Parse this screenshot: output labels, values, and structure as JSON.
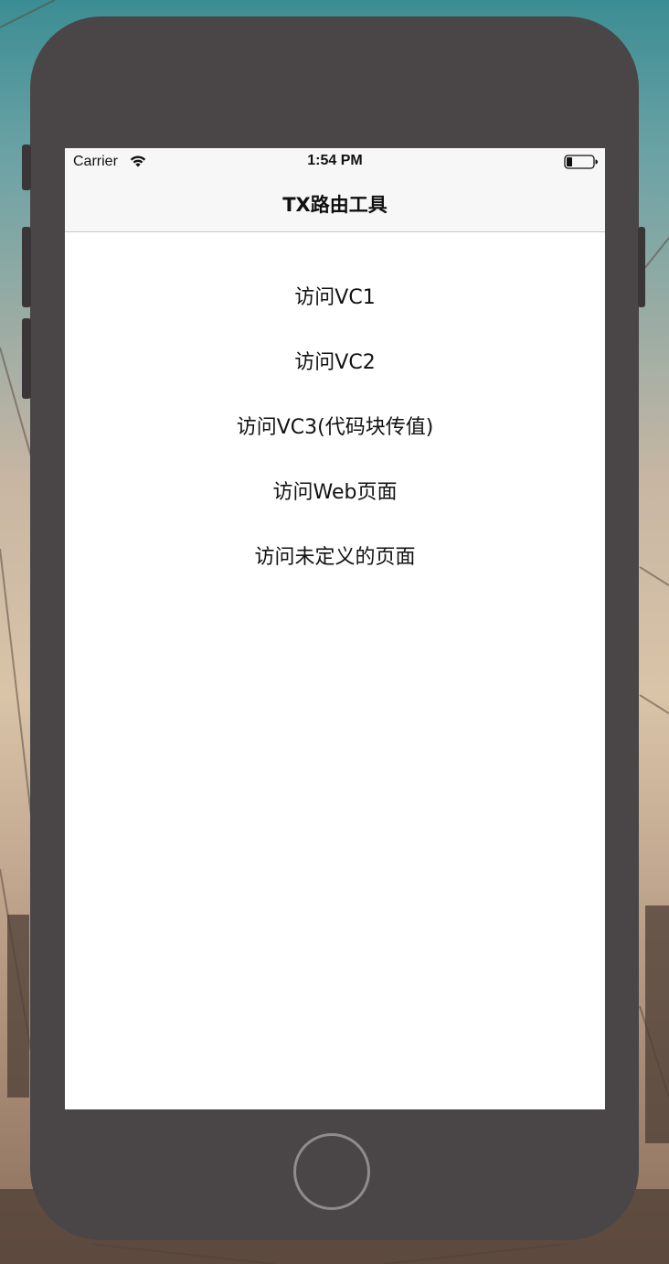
{
  "status_bar": {
    "carrier": "Carrier",
    "time": "1:54 PM",
    "wifi_icon": "wifi-icon",
    "battery_icon": "battery-icon"
  },
  "nav_bar": {
    "title": "TX路由工具"
  },
  "menu": {
    "items": [
      {
        "label": "访问VC1"
      },
      {
        "label": "访问VC2"
      },
      {
        "label": "访问VC3(代码块传值)"
      },
      {
        "label": "访问Web页面"
      },
      {
        "label": "访问未定义的页面"
      }
    ]
  },
  "device": {
    "home_button": "home-button"
  },
  "colors": {
    "device_body": "#4a4647",
    "nav_background": "#f7f7f7",
    "text": "#111111"
  }
}
